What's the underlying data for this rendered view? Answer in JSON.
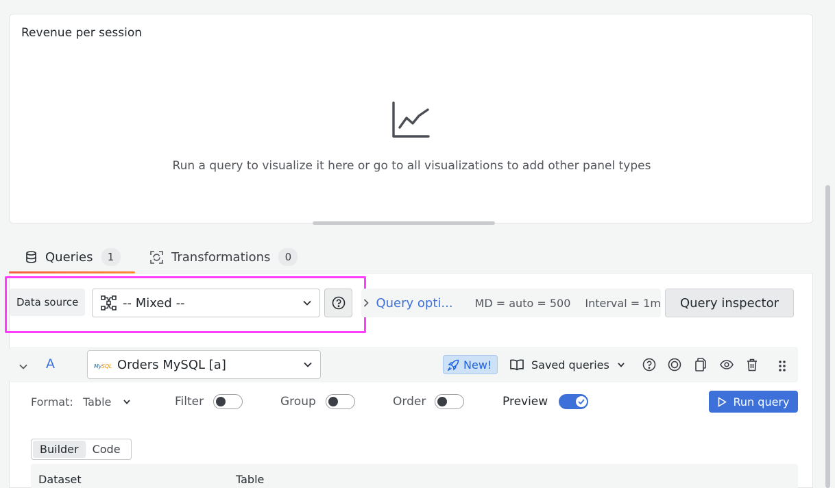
{
  "panel": {
    "title": "Revenue per session",
    "empty_message": "Run a query to visualize it here or go to all visualizations to add other panel types",
    "icon": "line-chart-icon"
  },
  "tabs": [
    {
      "label": "Queries",
      "count": "1",
      "icon": "database-icon",
      "active": true
    },
    {
      "label": "Transformations",
      "count": "0",
      "icon": "transform-icon",
      "active": false
    }
  ],
  "datasource": {
    "label": "Data source",
    "value": "-- Mixed --",
    "icon": "mixed-datasource-icon"
  },
  "query_options": {
    "link": "Query opti...",
    "max_data_points": "MD = auto = 500",
    "interval": "Interval = 1m"
  },
  "query_inspector_label": "Query inspector",
  "query": {
    "ref_id": "A",
    "datasource": "Orders MySQL [a]",
    "new_badge": "New!",
    "saved_queries": "Saved queries",
    "format_label": "Format:",
    "format_value": "Table",
    "filter_label": "Filter",
    "group_label": "Group",
    "order_label": "Order",
    "preview_label": "Preview",
    "filter_on": false,
    "group_on": false,
    "order_on": false,
    "preview_on": true,
    "run_label": "Run query",
    "modes": [
      "Builder",
      "Code"
    ],
    "active_mode": "Builder",
    "columns": [
      "Dataset",
      "Table"
    ]
  },
  "colors": {
    "accent": "#3d71d9",
    "highlight": "#ff3dff",
    "tab_underline": "#f55f3e"
  }
}
